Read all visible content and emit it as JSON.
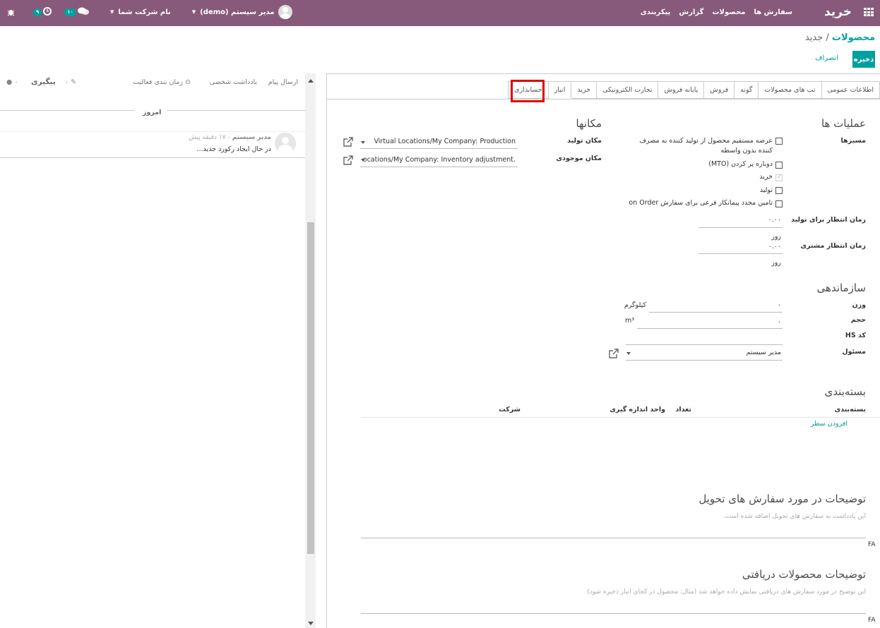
{
  "topbar": {
    "app_title": "خرید",
    "nav": [
      "سفارش ها",
      "محصولات",
      "گزارش",
      "پیکربندی"
    ],
    "user_name": "مدیر سیستم (demo)",
    "company": "نام شرکت شما",
    "messages_badge": "۱۰",
    "activity_badge": "۹"
  },
  "breadcrumb": {
    "parent": "محصولات",
    "separator": "/",
    "current": "جدید"
  },
  "actions": {
    "save": "ذخیره",
    "cancel": "انصراف"
  },
  "tabs": [
    "اطلاعات عمومی",
    "تب های محصولات",
    "گونه",
    "فروش",
    "پایانه فروش",
    "تجارت الکترونیکی",
    "خرید",
    "انبار",
    "حسابداری"
  ],
  "active_tab": "انبار",
  "operations": {
    "title": "عملیات ها",
    "routes_label": "مسیرها",
    "routes": [
      {
        "label_line1": "عرضه مستقیم محصول از تولید کننده به مصرف",
        "label_line2": "کننده بدون واسطه",
        "checked": false
      },
      {
        "label_line1": "دوباره پر کردن (MTO)",
        "checked": false
      },
      {
        "label_line1": "خرید",
        "checked": true
      },
      {
        "label_line1": "تولید",
        "checked": false
      },
      {
        "label_line1": "تامین مجدد پیمانکار فرعی برای سفارش on Order",
        "checked": false
      }
    ],
    "mfg_lead_label": "زمان انتظار برای تولید",
    "mfg_lead_value": "۰.۰۰",
    "mfg_lead_unit": "روز",
    "customer_lead_label": "زمان انتظار مشتری",
    "customer_lead_value": "۰.۰۰",
    "customer_lead_unit": "روز"
  },
  "locations": {
    "title": "مکانها",
    "production_label": "مکان تولید",
    "production_value": "Virtual Locations/My Company: Production",
    "inventory_label": "مکان موجودی",
    "inventory_value": ".ocations/My Company: Inventory adjustment"
  },
  "logistics": {
    "title": "سازماندهی",
    "weight_label": "وزن",
    "weight_value": "۰",
    "weight_unit": "کیلوگرم",
    "volume_label": "حجم",
    "volume_value": "۰",
    "volume_unit": "m³",
    "hs_label": "کد HS",
    "responsible_label": "مسئول",
    "responsible_value": "مدیر سیستم"
  },
  "packaging": {
    "title": "بسته‌بندی",
    "columns": [
      "بسته‌بندی",
      "تعداد",
      "واحد اندازه گیری",
      "شرکت"
    ],
    "add_line": "افزودن سطر"
  },
  "delivery_notes": {
    "title": "توضیحات در مورد سفارش های تحویل",
    "placeholder": "این یادداشت به سفارش های تحویل اضافه شده است.",
    "lang": "FA"
  },
  "receipt_notes": {
    "title": "توضیحات محصولات دریافتی",
    "placeholder": "این توضیح در مورد سفارش های دریافتی نمایش داده خواهد شد (مثال: محصول در کجای انبار ذخیره شود)",
    "lang": "FA"
  },
  "chatter": {
    "send_message": "ارسال پیام",
    "log_note": "یادداشت شخصی",
    "schedule_activity": "زمان بندی فعالیت",
    "attachments_count": "۰",
    "follow": "پیگیری",
    "followers_count": "۰",
    "today": "امروز",
    "message_author": "مدیر سیستم",
    "message_time": "- ۱۷ دقیقه پیش",
    "message_body": "در حال ایجاد رکورد جدید..."
  }
}
